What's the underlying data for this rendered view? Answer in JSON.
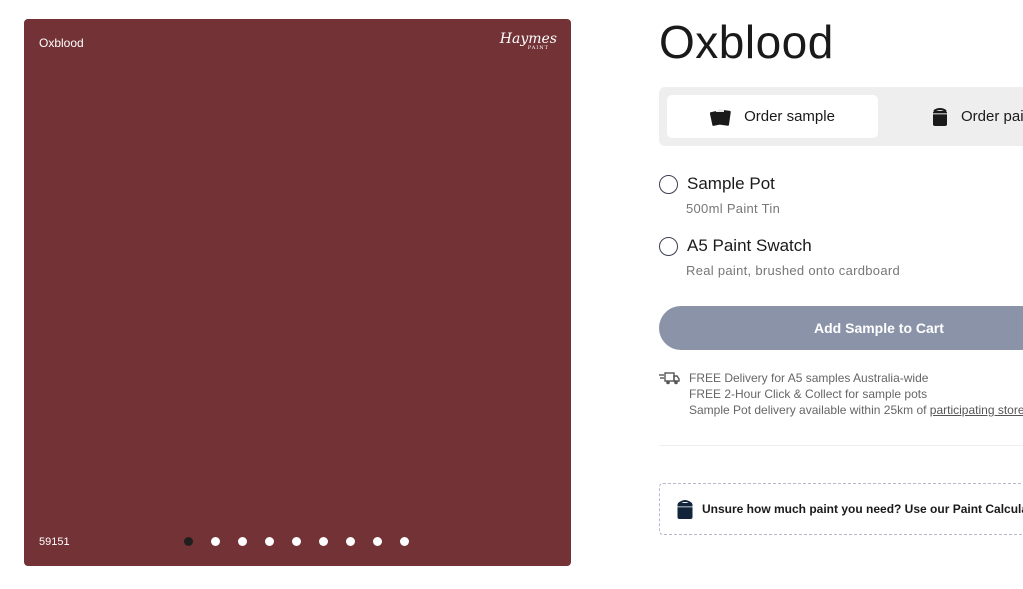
{
  "product": {
    "name": "Oxblood",
    "code": "59151",
    "brand": "Haymes",
    "brand_sub": "PAINT",
    "color": "#733236"
  },
  "gallery": {
    "dot_count": 9,
    "active_index": 0
  },
  "tabs": [
    {
      "label": "Order sample",
      "icon": "paint-swatch-cards-icon",
      "active": true
    },
    {
      "label": "Order paint",
      "icon": "paint-can-icon",
      "active": false
    }
  ],
  "options": [
    {
      "label": "Sample Pot",
      "sub": "500ml Paint Tin"
    },
    {
      "label": "A5 Paint Swatch",
      "sub": "Real paint, brushed onto cardboard"
    }
  ],
  "add_button": {
    "label": "Add Sample to Cart"
  },
  "delivery": {
    "icon": "delivery-truck-icon",
    "line1": "FREE Delivery for A5 samples Australia-wide",
    "line2": "FREE 2-Hour Click & Collect for sample pots",
    "line3_prefix": "Sample Pot delivery available within 25km of ",
    "line3_link": "participating stores"
  },
  "calculator": {
    "icon": "paint-can-icon",
    "text": "Unsure how much paint you need? Use our Paint Calculator"
  }
}
